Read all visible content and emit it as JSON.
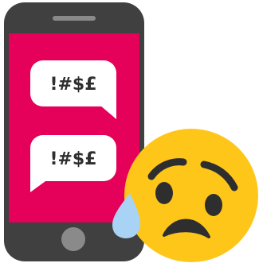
{
  "illustration": {
    "bubbles": [
      {
        "text": "!#$£"
      },
      {
        "text": "!#$£"
      }
    ],
    "colors": {
      "phone_body": "#404040",
      "phone_screen": "#e5005a",
      "speaker_slot": "#8a8a8a",
      "home_button": "#8a8a8a",
      "bubble_fill": "#ffffff",
      "bubble_text": "#2e2e2e",
      "emoji_face": "#ffc61a",
      "emoji_features": "#2e2e2e",
      "tear": "#a8d3f5"
    },
    "icons": [
      "smartphone-icon",
      "speech-bubble-icon",
      "sad-tear-emoji-icon"
    ]
  }
}
